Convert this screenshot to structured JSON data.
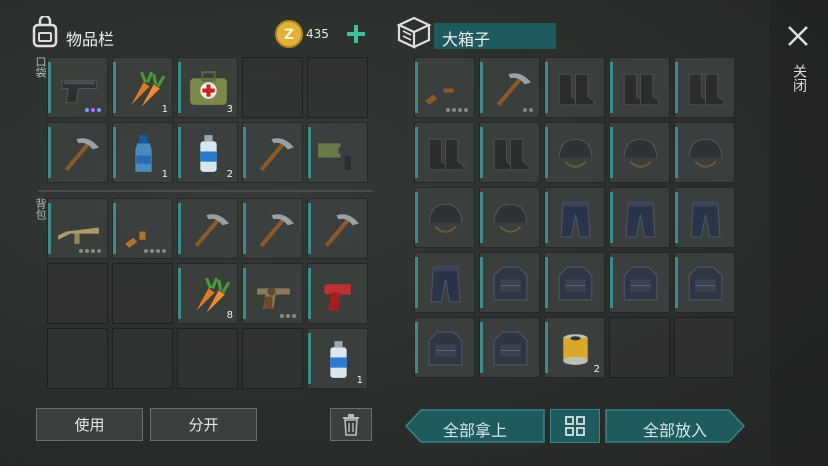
{
  "left": {
    "title": "物品栏",
    "coin_amount": "435",
    "pocket_label": "口袋",
    "backpack_label": "背包",
    "use_label": "使用",
    "split_label": "分开",
    "pocket_slots": [
      {
        "icon": "pistol-icon",
        "dots": 3,
        "dot_colors": [
          "#6fa0ff",
          "#b06fff",
          "#6fa0ff"
        ]
      },
      {
        "icon": "carrot-icon",
        "count": "1"
      },
      {
        "icon": "medkit-icon",
        "count": "3"
      },
      {
        "icon": null
      },
      {
        "icon": null
      },
      {
        "icon": "pickaxe-icon"
      },
      {
        "icon": "water-bottle-icon",
        "count": "1"
      },
      {
        "icon": "spray-can-icon",
        "count": "2"
      },
      {
        "icon": "pickaxe-icon"
      },
      {
        "icon": "flamethrower-icon"
      }
    ],
    "backpack_slots": [
      {
        "icon": "assault-rifle-icon",
        "dots": 4
      },
      {
        "icon": "rifle-icon",
        "dots": 4
      },
      {
        "icon": "pickaxe-icon"
      },
      {
        "icon": "pickaxe-icon"
      },
      {
        "icon": "pickaxe-icon"
      },
      {
        "icon": null
      },
      {
        "icon": null
      },
      {
        "icon": "carrot-icon",
        "count": "8"
      },
      {
        "icon": "revolver-icon",
        "dots": 3
      },
      {
        "icon": "flare-gun-icon"
      },
      {
        "icon": null
      },
      {
        "icon": null
      },
      {
        "icon": null
      },
      {
        "icon": null
      },
      {
        "icon": "spray-can-icon",
        "count": "1"
      }
    ]
  },
  "right": {
    "title": "大箱子",
    "take_all_label": "全部拿上",
    "put_all_label": "全部放入",
    "close_label": "关闭",
    "slots": [
      {
        "icon": "shotgun-icon",
        "dots": 4
      },
      {
        "icon": "pickaxe-icon",
        "dots": 2
      },
      {
        "icon": "boots-icon"
      },
      {
        "icon": "boots-icon"
      },
      {
        "icon": "boots-icon"
      },
      {
        "icon": "boots-icon"
      },
      {
        "icon": "boots-icon"
      },
      {
        "icon": "helmet-icon"
      },
      {
        "icon": "helmet-icon"
      },
      {
        "icon": "helmet-icon"
      },
      {
        "icon": "helmet-icon"
      },
      {
        "icon": "helmet-icon"
      },
      {
        "icon": "pants-icon"
      },
      {
        "icon": "pants-icon"
      },
      {
        "icon": "pants-icon"
      },
      {
        "icon": "pants-icon"
      },
      {
        "icon": "vest-icon"
      },
      {
        "icon": "vest-icon"
      },
      {
        "icon": "vest-icon"
      },
      {
        "icon": "vest-icon"
      },
      {
        "icon": "vest-icon"
      },
      {
        "icon": "vest-icon"
      },
      {
        "icon": "filter-icon",
        "count": "2"
      },
      {
        "icon": null
      },
      {
        "icon": null
      }
    ]
  },
  "colors": {
    "accent": "#3f8b8b",
    "coin": "#e0b23a",
    "plus": "#3fbfa0"
  }
}
